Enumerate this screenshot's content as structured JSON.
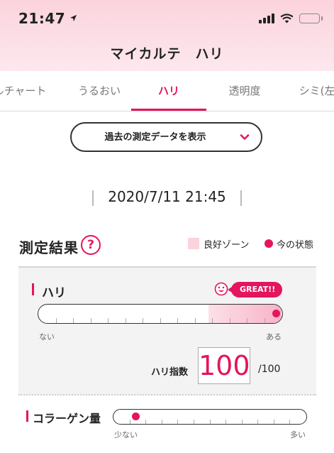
{
  "status_bar": {
    "time": "21:47"
  },
  "header": {
    "title": "マイカルテ　ハリ"
  },
  "tabs": [
    {
      "label": "ルチャート"
    },
    {
      "label": "うるおい"
    },
    {
      "label": "ハリ",
      "active": true
    },
    {
      "label": "透明度"
    },
    {
      "label": "シミ(左"
    }
  ],
  "history_button": {
    "label": "過去の測定データを表示"
  },
  "measurement": {
    "datetime": "2020/7/11 21:45"
  },
  "results": {
    "title": "測定結果",
    "help": "?",
    "legend_good": "良好ゾーン",
    "legend_now": "今の状態"
  },
  "hari": {
    "label": "ハリ",
    "badge": "GREAT!!",
    "min_label": "ない",
    "max_label": "ある",
    "good_zone": [
      0.7,
      1.0
    ],
    "current": 1.0,
    "score_label": "ハリ指数",
    "score": "100",
    "score_max": "/100"
  },
  "collagen": {
    "label": "コラーゲン量",
    "min_label": "少ない",
    "max_label": "多い",
    "current": 0.1
  },
  "colors": {
    "accent": "#e4155e",
    "good_zone": "#fbd3dd"
  }
}
